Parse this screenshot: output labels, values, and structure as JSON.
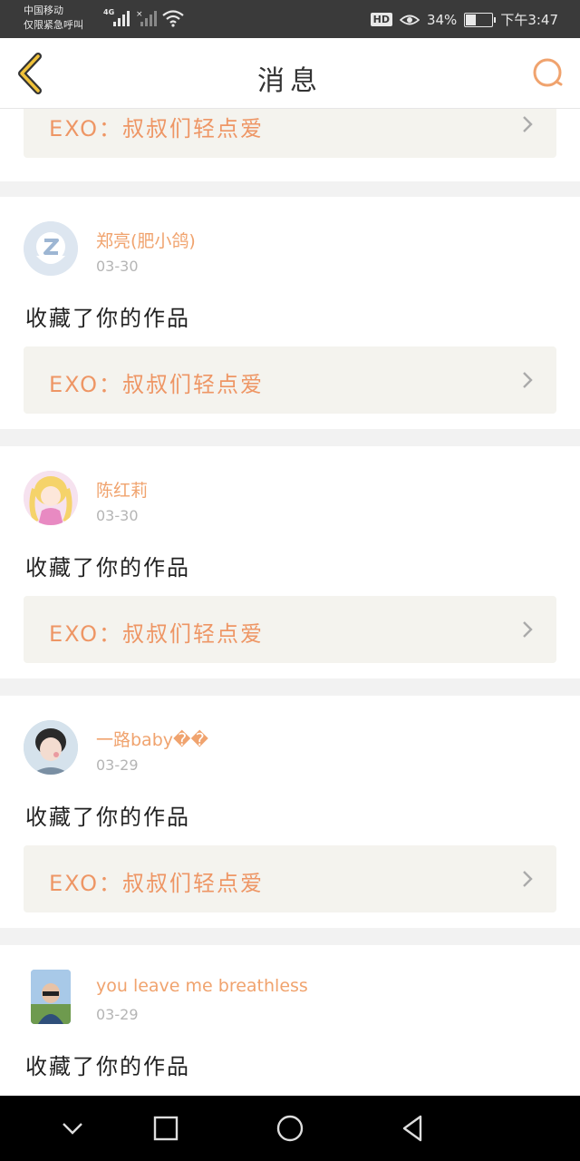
{
  "status_bar": {
    "carrier_line1": "中国移动",
    "carrier_line2": "仅限紧急呼叫",
    "network": "4G",
    "hd_label": "HD",
    "battery": "34%",
    "battery_level": 0.34,
    "time": "下午3:47"
  },
  "header": {
    "title": "消息",
    "back_icon": "chevron-left-icon",
    "search_icon": "search-icon",
    "accent_color": "#f0a36e"
  },
  "partial_top_card": {
    "work_title": "EXO：叔叔们轻点爱"
  },
  "notifications": [
    {
      "name": "郑亮(肥小鸽)",
      "date": "03-30",
      "action": "收藏了你的作品",
      "work_title": "EXO：叔叔们轻点爱"
    },
    {
      "name": "陈红莉",
      "date": "03-30",
      "action": "收藏了你的作品",
      "work_title": "EXO：叔叔们轻点爱"
    },
    {
      "name": "一路baby��",
      "date": "03-29",
      "action": "收藏了你的作品",
      "work_title": "EXO：叔叔们轻点爱"
    },
    {
      "name": "you leave me breathless",
      "date": "03-29",
      "action": "收藏了你的作品"
    }
  ],
  "nav_bar": {
    "icons": [
      "chevron-down-icon",
      "square-icon",
      "circle-icon",
      "triangle-back-icon"
    ]
  }
}
